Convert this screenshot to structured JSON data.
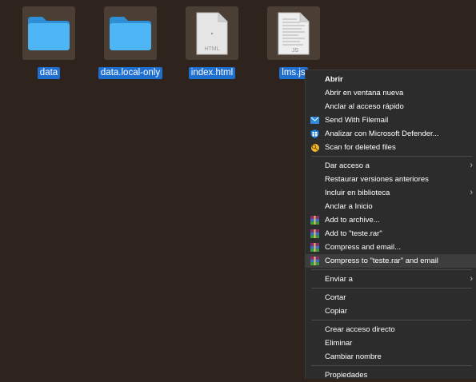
{
  "desktop": {
    "files": [
      {
        "name": "data",
        "icon": "folder-icon"
      },
      {
        "name": "data.local-only",
        "icon": "folder-icon"
      },
      {
        "name": "index.html",
        "icon": "html-file-icon",
        "badge": "HTML"
      },
      {
        "name": "lms.js",
        "icon": "js-file-icon",
        "badge": "JS"
      }
    ]
  },
  "context_menu": {
    "items": {
      "abrir": "Abrir",
      "abrir_ventana": "Abrir en ventana nueva",
      "anclar_acceso": "Anclar al acceso rápido",
      "send_filemail": "Send With Filemail",
      "defender": "Analizar con Microsoft Defender...",
      "scan_deleted": "Scan for deleted files",
      "dar_acceso": "Dar acceso a",
      "restaurar": "Restaurar versiones anteriores",
      "biblioteca": "Incluir en biblioteca",
      "anclar_inicio": "Anclar a Inicio",
      "add_archive": "Add to archive...",
      "add_teste": "Add to \"teste.rar\"",
      "compress_email": "Compress and email...",
      "compress_teste_email": "Compress to \"teste.rar\" and email",
      "enviar": "Enviar a",
      "cortar": "Cortar",
      "copiar": "Copiar",
      "crear_acceso": "Crear acceso directo",
      "eliminar": "Eliminar",
      "cambiar_nombre": "Cambiar nombre",
      "propiedades": "Propiedades"
    },
    "highlighted": "compress_teste_email"
  },
  "colors": {
    "background": "#2f241d",
    "selection": "#1f6fd1",
    "menu_bg": "#2c2c2c",
    "folder": "#45aef2"
  }
}
